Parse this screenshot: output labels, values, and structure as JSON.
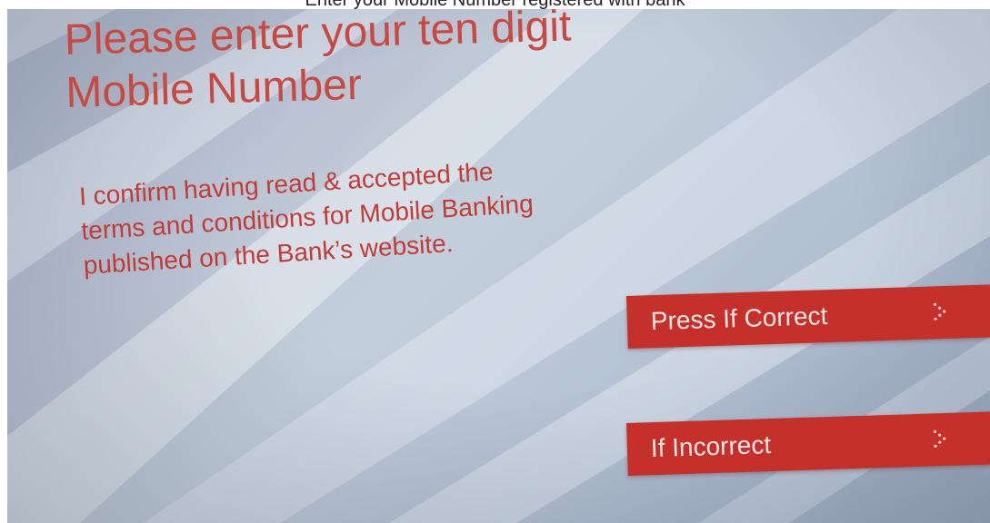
{
  "caption": "Enter your Mobile Number registered with bank",
  "atm_screen": {
    "title": "Please enter your ten digit\nMobile Number",
    "terms": "I confirm having read & accepted the\nterms and conditions for Mobile Banking\npublished on the Bank’s website.",
    "buttons": {
      "correct_label": "Press If Correct",
      "incorrect_label": "If Incorrect"
    },
    "button_icon": "chevron-right-icon"
  },
  "colors": {
    "accent_red": "#c6302b",
    "heading_red": "#c9483f",
    "screen_blue": "#b9c3d3"
  }
}
